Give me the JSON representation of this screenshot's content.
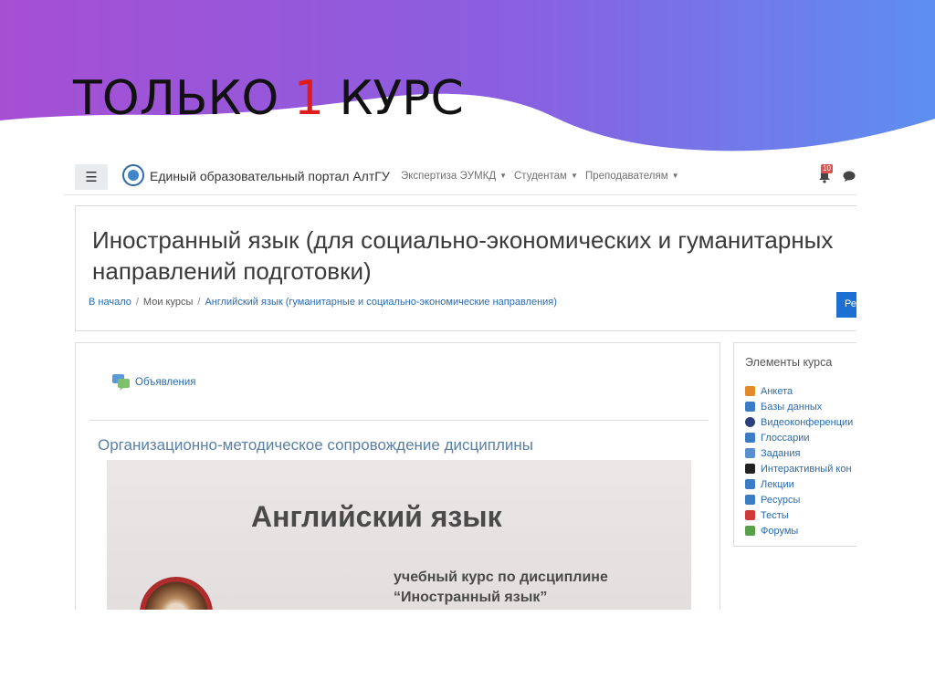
{
  "slide": {
    "title_pre": "ТОЛЬКО ",
    "title_accent": "1",
    "title_post": " КУРС",
    "accent_color": "#e01b1b"
  },
  "navbar": {
    "brand": "Единый образовательный портал АлтГУ",
    "items": [
      {
        "label": "Экспертиза ЭУМКД"
      },
      {
        "label": "Студентам"
      },
      {
        "label": "Преподавателям"
      }
    ],
    "notification_count": "10"
  },
  "course": {
    "title": "Иностранный язык (для социально-экономических и гуманитарных направлений подготовки)",
    "breadcrumb": [
      "В начало",
      "Мои курсы",
      "Английский язык (гуманитарные и социально-экономические направления)"
    ],
    "button_label": "Ре"
  },
  "main": {
    "announcements_label": "Объявления",
    "section_title": "Организационно-методическое сопровождение дисциплины",
    "image_title": "Английский язык",
    "image_subtitle_1": "учебный курс по дисциплине",
    "image_subtitle_2": "“Иностранный язык”"
  },
  "sidebar": {
    "title": "Элементы курса",
    "items": [
      {
        "label": "Анкета",
        "icon": "survey-icon",
        "color": "#e08a2a"
      },
      {
        "label": "Базы данных",
        "icon": "database-icon",
        "color": "#3b7cc4"
      },
      {
        "label": "Видеоконференции",
        "icon": "video-conference-icon",
        "color": "#2b3f7a"
      },
      {
        "label": "Глоссарии",
        "icon": "glossary-icon",
        "color": "#3b7cc4"
      },
      {
        "label": "Задания",
        "icon": "assignment-icon",
        "color": "#5a8fd0"
      },
      {
        "label": "Интерактивный кон",
        "icon": "interactive-content-icon",
        "color": "#222222"
      },
      {
        "label": "Лекции",
        "icon": "lesson-icon",
        "color": "#3b7cc4"
      },
      {
        "label": "Ресурсы",
        "icon": "resource-icon",
        "color": "#3b7cc4"
      },
      {
        "label": "Тесты",
        "icon": "quiz-icon",
        "color": "#d03a3a"
      },
      {
        "label": "Форумы",
        "icon": "forum-icon",
        "color": "#5aa04a"
      }
    ]
  }
}
